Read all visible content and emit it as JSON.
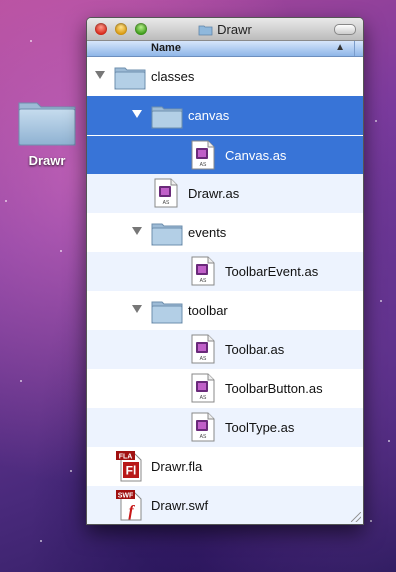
{
  "desktop": {
    "icon_label": "Drawr"
  },
  "window": {
    "title": "Drawr",
    "column_header": "Name",
    "sort_indicator": "▲"
  },
  "rows": [
    {
      "label": "classes",
      "icon": "folder-icon",
      "state": "expanded",
      "indent": 0,
      "selected": false,
      "alt": false
    },
    {
      "label": "canvas",
      "icon": "folder-icon",
      "state": "expanded",
      "indent": 1,
      "selected": true,
      "alt": false
    },
    {
      "label": "Canvas.as",
      "icon": "actionscript-file-icon",
      "state": "leaf",
      "indent": 2,
      "selected": true,
      "alt": false
    },
    {
      "label": "Drawr.as",
      "icon": "actionscript-file-icon",
      "state": "leaf",
      "indent": 1,
      "selected": false,
      "alt": true
    },
    {
      "label": "events",
      "icon": "folder-icon",
      "state": "expanded",
      "indent": 1,
      "selected": false,
      "alt": false
    },
    {
      "label": "ToolbarEvent.as",
      "icon": "actionscript-file-icon",
      "state": "leaf",
      "indent": 2,
      "selected": false,
      "alt": true
    },
    {
      "label": "toolbar",
      "icon": "folder-icon",
      "state": "expanded",
      "indent": 1,
      "selected": false,
      "alt": false
    },
    {
      "label": "Toolbar.as",
      "icon": "actionscript-file-icon",
      "state": "leaf",
      "indent": 2,
      "selected": false,
      "alt": true
    },
    {
      "label": "ToolbarButton.as",
      "icon": "actionscript-file-icon",
      "state": "leaf",
      "indent": 2,
      "selected": false,
      "alt": false
    },
    {
      "label": "ToolType.as",
      "icon": "actionscript-file-icon",
      "state": "leaf",
      "indent": 2,
      "selected": false,
      "alt": true
    },
    {
      "label": "Drawr.fla",
      "icon": "flash-fla-file-icon",
      "badge": "FLA",
      "glyph": "Fl",
      "state": "leaf",
      "indent": 0,
      "selected": false,
      "alt": false
    },
    {
      "label": "Drawr.swf",
      "icon": "flash-swf-file-icon",
      "badge": "SWF",
      "glyph": "f",
      "state": "leaf",
      "indent": 0,
      "selected": false,
      "alt": true
    }
  ],
  "colors": {
    "selection": "#3874d7",
    "alt_row": "#edf3fe",
    "folder": "#8fb8dc"
  }
}
